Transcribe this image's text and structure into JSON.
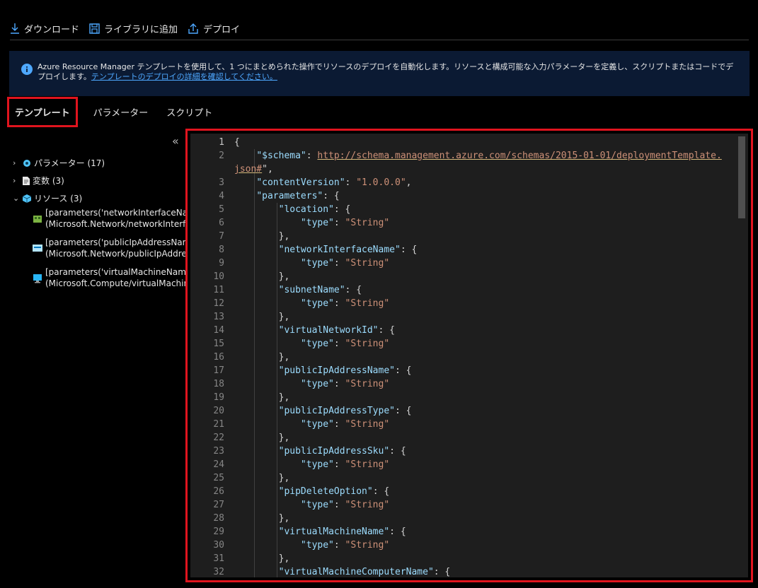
{
  "toolbar": {
    "download": "ダウンロード",
    "add_library": "ライブラリに追加",
    "deploy": "デプロイ"
  },
  "info": {
    "text": "Azure Resource Manager テンプレートを使用して、1 つにまとめられた操作でリソースのデプロイを自動化します。リソースと構成可能な入力パラメーターを定義し、スクリプトまたはコードでデプロイします。",
    "link": "テンプレートのデプロイの詳細を確認してください。"
  },
  "tabs": [
    "テンプレート",
    "パラメーター",
    "スクリプト"
  ],
  "tree": {
    "parameters": "パラメーター (17)",
    "variables": "変数 (3)",
    "resources": "リソース (3)",
    "resource_items": [
      {
        "line1": "[parameters('networkInterfaceNam",
        "line2": "(Microsoft.Network/networkInterfa"
      },
      {
        "line1": "[parameters('publicIpAddressNam",
        "line2": "(Microsoft.Network/publicIpAddre"
      },
      {
        "line1": "[parameters('virtualMachineName",
        "line2": "(Microsoft.Compute/virtualMachin"
      }
    ]
  },
  "editor": {
    "line_numbers": [
      "1",
      "2",
      "",
      "3",
      "4",
      "5",
      "6",
      "7",
      "8",
      "9",
      "10",
      "11",
      "12",
      "13",
      "14",
      "15",
      "16",
      "17",
      "18",
      "19",
      "20",
      "21",
      "22",
      "23",
      "24",
      "25",
      "26",
      "27",
      "28",
      "29",
      "30",
      "31",
      "32"
    ],
    "schema_key": "\"$schema\"",
    "schema_url_1": "http://schema.management.azure.com/schemas/2015-01-01/deploymentTemplate.",
    "schema_url_2": "json#",
    "content_version_key": "\"contentVersion\"",
    "content_version_val": "\"1.0.0.0\"",
    "parameters_key": "\"parameters\"",
    "type_key": "\"type\"",
    "type_val": "\"String\"",
    "param_names": [
      "\"location\"",
      "\"networkInterfaceName\"",
      "\"subnetName\"",
      "\"virtualNetworkId\"",
      "\"publicIpAddressName\"",
      "\"publicIpAddressType\"",
      "\"publicIpAddressSku\"",
      "\"pipDeleteOption\"",
      "\"virtualMachineName\"",
      "\"virtualMachineComputerName\""
    ]
  },
  "colors": {
    "highlight": "#e0141e",
    "info_bg": "#0b1a33",
    "link": "#4ea8ff",
    "editor_bg": "#1e1e1e"
  }
}
